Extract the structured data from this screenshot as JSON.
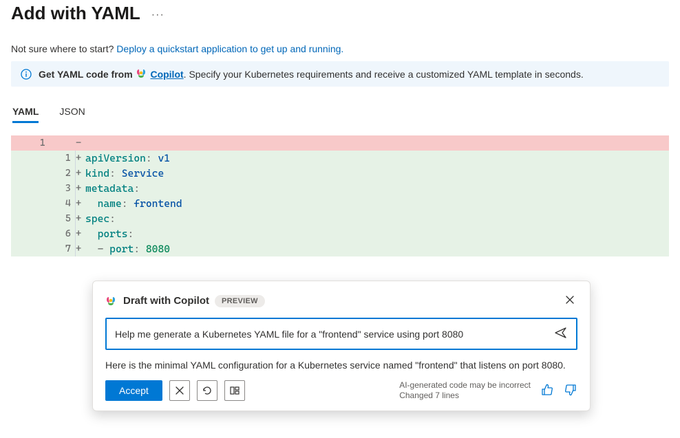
{
  "header": {
    "title": "Add with YAML"
  },
  "start_line": {
    "prefix": "Not sure where to start? ",
    "link": "Deploy a quickstart application to get up and running."
  },
  "banner": {
    "prefix_bold": "Get YAML code from ",
    "copilot_label": "Copilot",
    "suffix": ". Specify your Kubernetes requirements and receive a customized YAML template in seconds."
  },
  "tabs": [
    {
      "label": "YAML",
      "active": true
    },
    {
      "label": "JSON",
      "active": false
    }
  ],
  "editor": {
    "removed_line_no": "1",
    "removed_content": "",
    "added_lines": [
      {
        "n": "1",
        "key": "apiVersion",
        "punct": ": ",
        "val": "v1",
        "valClass": "tok-str",
        "indent": ""
      },
      {
        "n": "2",
        "key": "kind",
        "punct": ": ",
        "val": "Service",
        "valClass": "tok-str",
        "indent": ""
      },
      {
        "n": "3",
        "key": "metadata",
        "punct": ":",
        "val": "",
        "valClass": "",
        "indent": ""
      },
      {
        "n": "4",
        "key": "name",
        "punct": ": ",
        "val": "frontend",
        "valClass": "tok-str",
        "indent": "  "
      },
      {
        "n": "5",
        "key": "spec",
        "punct": ":",
        "val": "",
        "valClass": "",
        "indent": ""
      },
      {
        "n": "6",
        "key": "ports",
        "punct": ":",
        "val": "",
        "valClass": "",
        "indent": "  "
      },
      {
        "n": "7",
        "prefix": "- ",
        "key": "port",
        "punct": ": ",
        "val": "8080",
        "valClass": "tok-num",
        "indent": "  "
      }
    ]
  },
  "copilot": {
    "title": "Draft with Copilot",
    "badge": "PREVIEW",
    "prompt": "Help me generate a Kubernetes YAML file for a \"frontend\" service using port 8080",
    "response": "Here is the minimal YAML configuration for a Kubernetes service named \"frontend\" that listens on port 8080.",
    "accept_label": "Accept",
    "disclaimer_line1": "AI-generated code may be incorrect",
    "disclaimer_line2": "Changed 7 lines"
  }
}
